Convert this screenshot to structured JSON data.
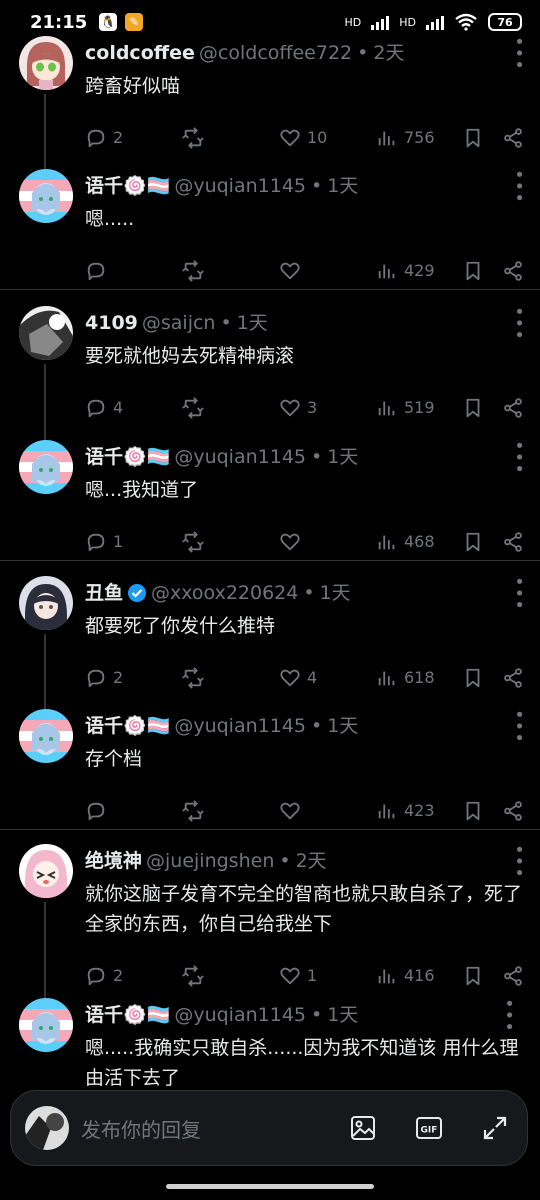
{
  "status": {
    "time": "21:15",
    "battery": "76",
    "hd1": "HD",
    "hd2": "HD"
  },
  "tweets": [
    {
      "name": "coldcoffee",
      "handle": "@coldcoffee722",
      "time": "2天",
      "text": "跨畜好似喵",
      "replies": "2",
      "retweets": "",
      "likes": "10",
      "views": "756",
      "avatar": "girl-brown"
    },
    {
      "name": "语千🍥🏳️‍⚧️",
      "handle": "@yuqian1145",
      "time": "1天",
      "text": "嗯.....",
      "replies": "",
      "retweets": "",
      "likes": "",
      "views": "429",
      "avatar": "trans"
    },
    {
      "name": "4109",
      "handle": "@saijcn",
      "time": "1天",
      "text": "要死就他妈去死精神病滚",
      "replies": "4",
      "retweets": "",
      "likes": "3",
      "views": "519",
      "avatar": "mono"
    },
    {
      "name": "语千🍥🏳️‍⚧️",
      "handle": "@yuqian1145",
      "time": "1天",
      "text": "嗯...我知道了",
      "replies": "1",
      "retweets": "",
      "likes": "",
      "views": "468",
      "avatar": "trans"
    },
    {
      "name": "丑鱼",
      "handle": "@xxoox220624",
      "time": "1天",
      "text": "都要死了你发什么推特",
      "replies": "2",
      "retweets": "",
      "likes": "4",
      "views": "618",
      "avatar": "dark-girl",
      "verified": true
    },
    {
      "name": "语千🍥🏳️‍⚧️",
      "handle": "@yuqian1145",
      "time": "1天",
      "text": "存个档",
      "replies": "",
      "retweets": "",
      "likes": "",
      "views": "423",
      "avatar": "trans"
    },
    {
      "name": "绝境神",
      "handle": "@juejingshen",
      "time": "2天",
      "text": "就你这脑子发育不完全的智商也就只敢自杀了，死了全家的东西，你自己给我坐下",
      "replies": "2",
      "retweets": "",
      "likes": "1",
      "views": "416",
      "avatar": "pink-girl"
    },
    {
      "name": "语千🍥🏳️‍⚧️",
      "handle": "@yuqian1145",
      "time": "1天",
      "text": "嗯.....我确实只敢自杀......因为我不知道该 用什么理由活下去了",
      "replies": "",
      "retweets": "",
      "likes": "",
      "views": "",
      "avatar": "trans"
    }
  ],
  "reply_bar": {
    "placeholder": "发布你的回复",
    "gif_label": "GIF"
  },
  "colors": {
    "background": "#000000",
    "text": "#e7e9ea",
    "muted": "#71767b",
    "verified": "#1d9bf0"
  }
}
